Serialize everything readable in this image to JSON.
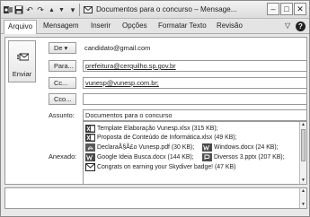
{
  "window": {
    "title": "Documentos para o concurso – Mensage...",
    "minimize_label": "–",
    "restore_label": "□",
    "close_label": "✕"
  },
  "quick_access": {
    "save_glyph": "▪",
    "undo_glyph": "↶",
    "redo_glyph": "↷",
    "up_glyph": "▲",
    "down_glyph": "▼",
    "customize_glyph": "▾"
  },
  "ribbon": {
    "tabs": [
      {
        "label": "Arquivo"
      },
      {
        "label": "Mensagem"
      },
      {
        "label": "Inserir"
      },
      {
        "label": "Opções"
      },
      {
        "label": "Formatar Texto"
      },
      {
        "label": "Revisão"
      }
    ],
    "collapse_glyph": "▽",
    "help_glyph": "?"
  },
  "compose": {
    "send_label": "Enviar",
    "from_button": "De ▾",
    "from_value": "candidato@gmail.com",
    "to_button": "Para...",
    "to_value": "prefeitura@cerquilho.sp.gov.br",
    "cc_button": "Cc...",
    "cc_value": "vunesp@vunesp.com.br;",
    "bcc_button": "Cco...",
    "bcc_value": "",
    "subject_label": "Assunto:",
    "subject_value": "Documentos para o concurso",
    "attach_label": "Anexado:",
    "attachments": [
      {
        "name": "Template Elaboração Vunesp.xlsx (315 KB);",
        "icon": "excel-file-icon"
      },
      {
        "name": "Proposta de Conteúdo de Informática.xlsx (49 KB);",
        "icon": "excel-file-icon"
      },
      {
        "name": "DeclaraÃ§Ã£o Vunesp.pdf (30 KB);",
        "icon": "pdf-file-icon"
      },
      {
        "name": "Windows.docx (24 KB);",
        "icon": "word-file-icon"
      },
      {
        "name": "Google Ideia Busca.docx (144 KB);",
        "icon": "word-file-icon"
      },
      {
        "name": "Diversos 3.pptx (207 KB);",
        "icon": "powerpoint-file-icon"
      },
      {
        "name": "Congrats on earning your Skydiver badge! (47 KB)",
        "icon": "email-message-icon"
      }
    ]
  },
  "colors": {
    "excel": "#3a3a3a",
    "word": "#4a4a4a",
    "pdf": "#5a5a5a",
    "ppt": "#505050"
  }
}
